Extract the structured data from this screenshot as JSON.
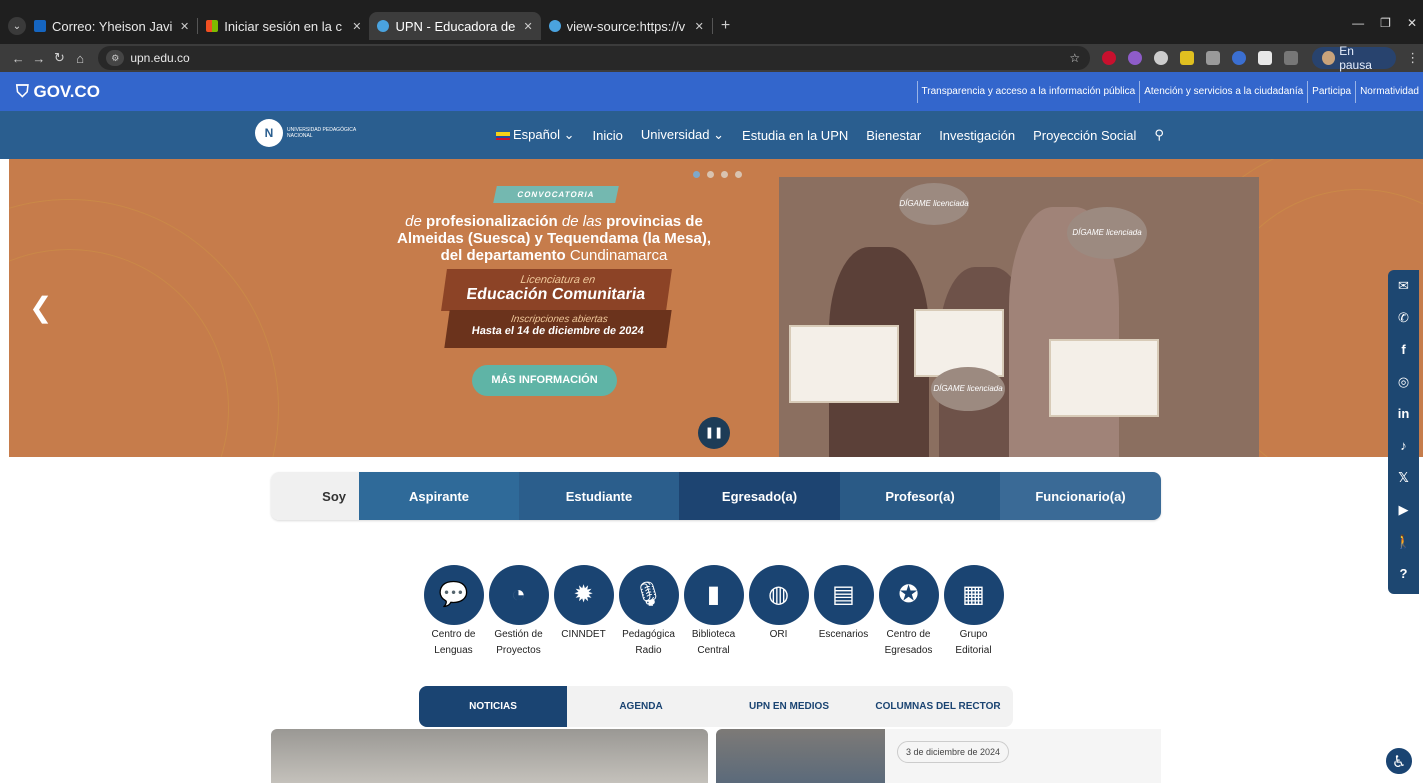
{
  "browser": {
    "tabs": [
      {
        "title": "Correo: Yheison Javie",
        "color": "#1565c0"
      },
      {
        "title": "Iniciar sesión en la c",
        "color": "#f25022"
      },
      {
        "title": "UPN - Educadora de",
        "color": "#4aa3df"
      },
      {
        "title": "view-source:https://v",
        "color": "#4aa3df"
      }
    ],
    "url": "upn.edu.co",
    "profile_label": "En pausa"
  },
  "gov": {
    "logo": "GOV.CO",
    "links": [
      "Transparencia y acceso a la información pública",
      "Atención y servicios a la ciudadanía",
      "Participa",
      "Normatividad"
    ]
  },
  "nav": {
    "logo_text": "UNIVERSIDAD PEDAGÓGICA NACIONAL",
    "items": [
      "Español",
      "Inicio",
      "Universidad",
      "Estudia en la UPN",
      "Bienestar",
      "Investigación",
      "Proyección Social"
    ]
  },
  "hero": {
    "badge": "CONVOCATORIA",
    "heading_line1_light": "de",
    "heading_line1_bold": "profesionalización",
    "heading_line1_light2": "de las",
    "heading_line1_bold2": "provincias de",
    "heading_line2": "Almeidas (Suesca) y Tequendama (la Mesa),",
    "heading_line3_bold": "del departamento",
    "heading_line3_light": "Cundinamarca",
    "program_sub": "Licenciatura en",
    "program_main": "Educación Comunitaria",
    "ins_sub": "Inscripciones abiertas",
    "ins_main": "Hasta el 14 de diciembre de 2024",
    "cta": "MÁS INFORMACIÓN",
    "sign_text": "DÍGAME licenciada"
  },
  "profiles": {
    "label": "Soy",
    "items": [
      {
        "label": "Aspirante",
        "color": "#2f6a99"
      },
      {
        "label": "Estudiante",
        "color": "#2b5e8c"
      },
      {
        "label": "Egresado(a)",
        "color": "#1d4471"
      },
      {
        "label": "Profesor(a)",
        "color": "#2a5a86"
      },
      {
        "label": "Funcionario(a)",
        "color": "#3a6a96"
      }
    ]
  },
  "quick_access": [
    {
      "l1": "Centro de",
      "l2": "Lenguas",
      "icon": "chat-icon",
      "glyph": "💬"
    },
    {
      "l1": "Gestión de",
      "l2": "Proyectos",
      "icon": "pie-icon",
      "glyph": "◔"
    },
    {
      "l1": "CINNDET",
      "l2": "",
      "icon": "network-icon",
      "glyph": "✹"
    },
    {
      "l1": "Pedagógica",
      "l2": "Radio",
      "icon": "microphone-icon",
      "glyph": "🎙"
    },
    {
      "l1": "Biblioteca",
      "l2": "Central",
      "icon": "book-icon",
      "glyph": "▮"
    },
    {
      "l1": "ORI",
      "l2": "",
      "icon": "globe-icon",
      "glyph": "◍"
    },
    {
      "l1": "Escenarios",
      "l2": "",
      "icon": "document-icon",
      "glyph": "▤"
    },
    {
      "l1": "Centro de",
      "l2": "Egresados",
      "icon": "award-icon",
      "glyph": "✪"
    },
    {
      "l1": "Grupo",
      "l2": "Editorial",
      "icon": "newspaper-icon",
      "glyph": "▦"
    }
  ],
  "news_tabs": [
    "NOTICIAS",
    "AGENDA",
    "UPN EN MEDIOS",
    "COLUMNAS DEL RECTOR"
  ],
  "news": {
    "date": "3 de diciembre de 2024"
  },
  "social": [
    {
      "icon": "mail-icon",
      "glyph": "✉"
    },
    {
      "icon": "whatsapp-icon",
      "glyph": "✆"
    },
    {
      "icon": "facebook-icon",
      "glyph": "f"
    },
    {
      "icon": "instagram-icon",
      "glyph": "◎"
    },
    {
      "icon": "linkedin-icon",
      "glyph": "in"
    },
    {
      "icon": "tiktok-icon",
      "glyph": "♪"
    },
    {
      "icon": "x-icon",
      "glyph": "𝕏"
    },
    {
      "icon": "youtube-icon",
      "glyph": "▶"
    },
    {
      "icon": "accessibility-person-icon",
      "glyph": "🚶"
    },
    {
      "icon": "help-icon",
      "glyph": "?"
    }
  ]
}
